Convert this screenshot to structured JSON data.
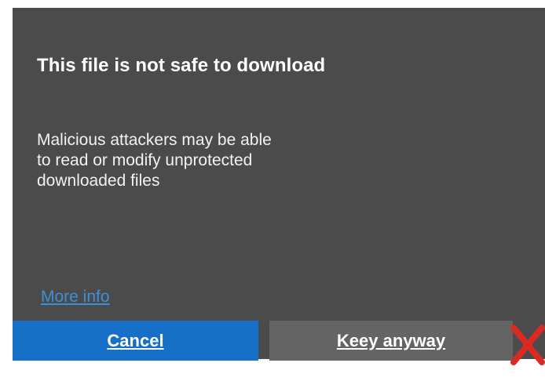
{
  "dialog": {
    "title": "This file is not safe to download",
    "message": "Malicious attackers may be able\nto read or modify unprotected\ndownloaded files",
    "more_info_label": "More info",
    "buttons": {
      "cancel_label": "Cancel",
      "keep_label": "Keey anyway"
    }
  },
  "colors": {
    "dialog_background": "#4b4b4b",
    "cancel_button": "#1770c8",
    "keep_button": "#646464",
    "link": "#3f8fd6",
    "close_mark": "#d92b22"
  },
  "icons": {
    "close_mark": "red-x-icon"
  }
}
